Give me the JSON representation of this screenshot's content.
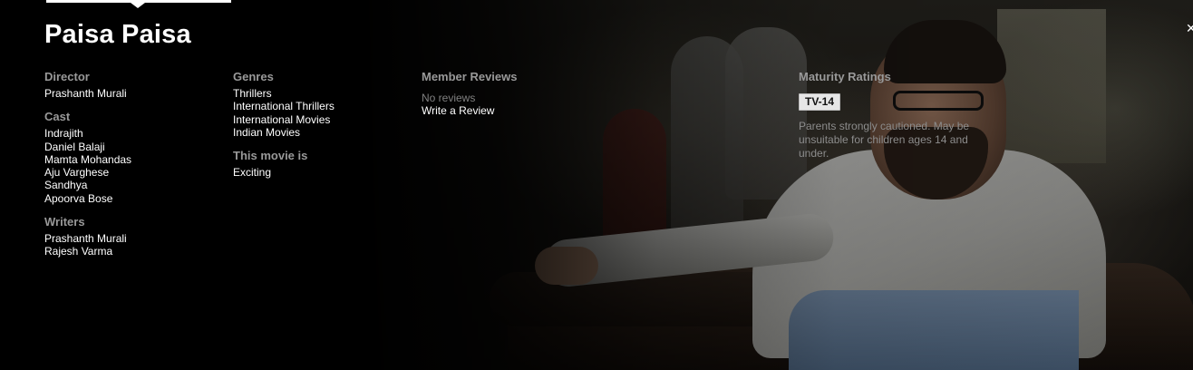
{
  "title": "Paisa Paisa",
  "director": {
    "label": "Director",
    "names": [
      "Prashanth Murali"
    ]
  },
  "cast": {
    "label": "Cast",
    "names": [
      "Indrajith",
      "Daniel Balaji",
      "Mamta Mohandas",
      "Aju Varghese",
      "Sandhya",
      "Apoorva Bose"
    ]
  },
  "writers": {
    "label": "Writers",
    "names": [
      "Prashanth Murali",
      "Rajesh Varma"
    ]
  },
  "genres": {
    "label": "Genres",
    "items": [
      "Thrillers",
      "International Thrillers",
      "International Movies",
      "Indian Movies"
    ]
  },
  "this_movie_is": {
    "label": "This movie is",
    "items": [
      "Exciting"
    ]
  },
  "reviews": {
    "label": "Member Reviews",
    "empty_text": "No reviews",
    "write_label": "Write a Review"
  },
  "maturity": {
    "label": "Maturity Ratings",
    "rating": "TV-14",
    "description": "Parents strongly cautioned. May be unsuitable for children ages 14 and under."
  },
  "icons": {
    "close": "close-icon"
  },
  "colors": {
    "background": "#000000",
    "label_gray": "#999999",
    "badge_bg": "#e6e6e6"
  }
}
